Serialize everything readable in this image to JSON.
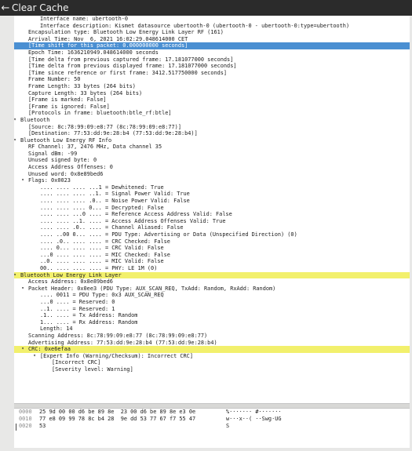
{
  "window": {
    "title": "Clear Cache"
  },
  "tree": [
    {
      "text": "Interface name: ubertooth-0",
      "indent": 5
    },
    {
      "text": "Interface description: Kismet datasource ubertooth-0 (ubertooth-0 - ubertooth-0:type=ubertooth)",
      "indent": 5
    },
    {
      "text": "Encapsulation type: Bluetooth Low Energy Link Layer RF (161)",
      "indent": 2
    },
    {
      "text": "Arrival Time: Nov  6, 2021 16:02:29.048614000 CET",
      "indent": 2
    },
    {
      "text": "[Time shift for this packet: 0.000000000 seconds]",
      "indent": 2,
      "state": "selected"
    },
    {
      "text": "Epoch Time: 1636210949.048614000 seconds",
      "indent": 2
    },
    {
      "text": "[Time delta from previous captured frame: 17.181077000 seconds]",
      "indent": 2
    },
    {
      "text": "[Time delta from previous displayed frame: 17.181077000 seconds]",
      "indent": 2
    },
    {
      "text": "[Time since reference or first frame: 3412.517750000 seconds]",
      "indent": 2
    },
    {
      "text": "Frame Number: 50",
      "indent": 2
    },
    {
      "text": "Frame Length: 33 bytes (264 bits)",
      "indent": 2
    },
    {
      "text": "Capture Length: 33 bytes (264 bits)",
      "indent": 2
    },
    {
      "text": "[Frame is marked: False]",
      "indent": 2
    },
    {
      "text": "[Frame is ignored: False]",
      "indent": 2
    },
    {
      "text": "[Protocols in frame: bluetooth:btle_rf:btle]",
      "indent": 2
    },
    {
      "text": "Bluetooth",
      "indent": 0,
      "arrow": "▾"
    },
    {
      "text": "[Source: 8c:78:99:09:e8:77 (8c:78:99:09:e8:77)]",
      "indent": 2
    },
    {
      "text": "[Destination: 77:53:dd:9e:28:b4 (77:53:dd:9e:28:b4)]",
      "indent": 2
    },
    {
      "text": "Bluetooth Low Energy RF Info",
      "indent": 0,
      "arrow": "▾"
    },
    {
      "text": "RF Channel: 37, 2476 MHz, Data channel 35",
      "indent": 2
    },
    {
      "text": "Signal dBm: -99",
      "indent": 2
    },
    {
      "text": "Unused signed byte: 0",
      "indent": 2
    },
    {
      "text": "Access Address Offenses: 0",
      "indent": 2
    },
    {
      "text": "Unused word: 0x8e89bed6",
      "indent": 2
    },
    {
      "text": "Flags: 0x0023",
      "indent": 2,
      "arrow": "▾"
    },
    {
      "text": ".... .... .... ...1 = Dewhitened: True",
      "indent": 5
    },
    {
      "text": ".... .... .... ..1. = Signal Power Valid: True",
      "indent": 5
    },
    {
      "text": ".... .... .... .0.. = Noise Power Valid: False",
      "indent": 5
    },
    {
      "text": ".... .... .... 0... = Decrypted: False",
      "indent": 5
    },
    {
      "text": ".... .... ...0 .... = Reference Access Address Valid: False",
      "indent": 5
    },
    {
      "text": ".... .... ..1. .... = Access Address Offenses Valid: True",
      "indent": 5
    },
    {
      "text": ".... .... .0.. .... = Channel Aliased: False",
      "indent": 5
    },
    {
      "text": ".... ..00 0... .... = PDU Type: Advertising or Data (Unspecified Direction) (0)",
      "indent": 5
    },
    {
      "text": ".... .0.. .... .... = CRC Checked: False",
      "indent": 5
    },
    {
      "text": ".... 0... .... .... = CRC Valid: False",
      "indent": 5
    },
    {
      "text": "...0 .... .... .... = MIC Checked: False",
      "indent": 5
    },
    {
      "text": "..0. .... .... .... = MIC Valid: False",
      "indent": 5
    },
    {
      "text": "00.. .... .... .... = PHY: LE 1M (0)",
      "indent": 5
    },
    {
      "text": "Bluetooth Low Energy Link Layer",
      "indent": 0,
      "arrow": "▾",
      "state": "highlight"
    },
    {
      "text": "Access Address: 0x8e89bed6",
      "indent": 2
    },
    {
      "text": "Packet Header: 0x0ee3 (PDU Type: AUX_SCAN_REQ, TxAdd: Random, RxAdd: Random)",
      "indent": 2,
      "arrow": "▾"
    },
    {
      "text": ".... 0011 = PDU Type: 0x3 AUX_SCAN_REQ",
      "indent": 5
    },
    {
      "text": "...0 .... = Reserved: 0",
      "indent": 5
    },
    {
      "text": "..1. .... = Reserved: 1",
      "indent": 5
    },
    {
      "text": ".1.. .... = Tx Address: Random",
      "indent": 5
    },
    {
      "text": "1... .... = Rx Address: Random",
      "indent": 5
    },
    {
      "text": "Length: 14",
      "indent": 5
    },
    {
      "text": "Scanning Address: 8c:78:99:09:e8:77 (8c:78:99:09:e8:77)",
      "indent": 2
    },
    {
      "text": "Advertising Address: 77:53:dd:9e:28:b4 (77:53:dd:9e:28:b4)",
      "indent": 2
    },
    {
      "text": "CRC: 0xe6efaa",
      "indent": 2,
      "arrow": "▾",
      "state": "highlight"
    },
    {
      "text": "[Expert Info (Warning/Checksum): Incorrect CRC]",
      "indent": 5,
      "arrow": "▾"
    },
    {
      "text": "[Incorrect CRC]",
      "indent": 8
    },
    {
      "text": "[Severity level: Warning]",
      "indent": 8
    }
  ],
  "hex": [
    {
      "offset": "0000",
      "bytes": "25 9d 00 00 d6 be 89 8e  23 00 d6 be 89 8e e3 0e",
      "ascii": "%······· #·······"
    },
    {
      "offset": "0010",
      "bytes": "77 e8 09 99 78 8c b4 28  9e dd 53 77 67 f7 55 47",
      "ascii": "w···x··( ··Swg·UG"
    },
    {
      "offset": "0020",
      "bytes": "53",
      "ascii": "S"
    }
  ],
  "colors": {
    "selection": "#4a8fd2",
    "highlight": "#f2f06c",
    "titlebar": "#2b2b2b"
  },
  "icons": {
    "back": "left-arrow-icon",
    "expand": "expand-arrow-icon"
  }
}
